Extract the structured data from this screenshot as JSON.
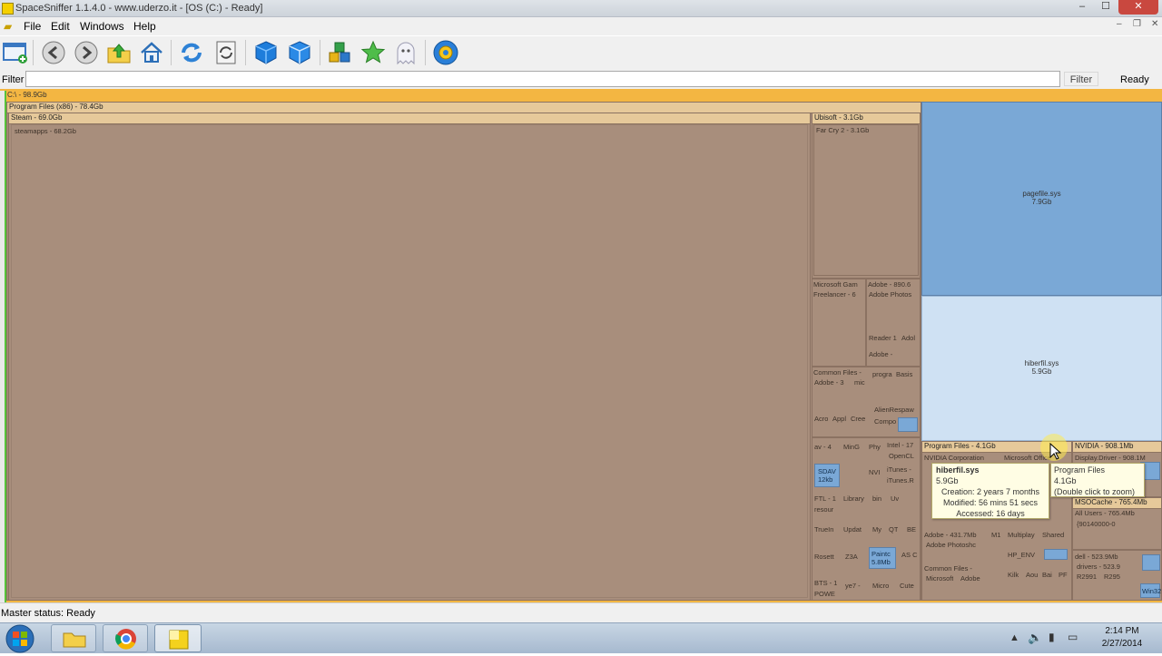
{
  "window": {
    "title": "SpaceSniffer 1.1.4.0 - www.uderzo.it - [OS (C:) - Ready]"
  },
  "menu": {
    "file": "File",
    "edit": "Edit",
    "windows": "Windows",
    "help": "Help"
  },
  "filter": {
    "label": "Filter",
    "value": "",
    "button": "Filter",
    "state": "Ready"
  },
  "treemap": {
    "root": "C:\\ - 98.9Gb",
    "program_files_x86": "Program Files (x86) - 78.4Gb",
    "steam": "Steam - 69.0Gb",
    "steamapps": "steamapps - 68.2Gb",
    "ubisoft": "Ubisoft - 3.1Gb",
    "far_cry": "Far Cry 2 - 3.1Gb",
    "microsoft_games": "Microsoft Gam",
    "freelancer": "Freelancer - 6",
    "adobe": "Adobe - 890.6",
    "adobe_photoshop": "Adobe Photos",
    "reader": "Reader 1",
    "adobe_small": "Adol",
    "adobe_dash": "Adobe -",
    "common_files": "Common Files -",
    "adobe_3": "Adobe - 3",
    "mic": "mic",
    "progra": "progra",
    "basis": "Basis",
    "alienrespawn": "AlienRespaw",
    "compo": "Compo",
    "acro": "Acro",
    "appl": "Appl",
    "cree": "Cree",
    "av": "av - 4",
    "ming": "MinG",
    "phy": "Phy",
    "intel": "Intel - 17",
    "opencl": "OpenCL",
    "sdav": "SDAV",
    "sdav_size": "12kb",
    "nvi": "NVI",
    "itunes": "iTunes -",
    "itunes2": "iTunes.R",
    "ftl": "FTL - 1",
    "resour": "resour",
    "library": "Library",
    "bin": "bin",
    "uv": "Uv",
    "truein": "TrueIn",
    "updat": "Updat",
    "my": "My",
    "qt": "QT",
    "be": "BE",
    "rosett": "Rosett",
    "z3a": "Z3A",
    "paintc": "Paintc",
    "paintc_size": "5.8Mb",
    "asc": "AS C",
    "bts": "BTS - 1",
    "powe": "POWE",
    "ye7": "ye7 -",
    "micro": "Micro",
    "cute": "Cute",
    "pagefile": "pagefile.sys",
    "pagefile_size": "7.9Gb",
    "hiberfil": "hiberfil.sys",
    "hiberfil_size": "5.9Gb",
    "program_files": "Program Files - 4.1Gb",
    "nvidia_corp": "NVIDIA Corporation",
    "microsoft_office": "Microsoft Office",
    "nvidia": "NVIDIA - 908.1Mb",
    "display_driver": "Display.Driver - 908.1M",
    "msocache": "MSOCache - 765.4Mb",
    "all_users": "All Users - 765.4Mb",
    "guid": "{90140000-0",
    "adobe_431": "Adobe - 431.7Mb",
    "adobe_photoshop2": "Adobe Photoshc",
    "m1": "M1",
    "multiplay": "Multiplay",
    "shared": "Shared",
    "hp_env": "HP_ENV",
    "common_files2": "Common Files -",
    "microsoft": "Microsoft",
    "adobe2": "Adobe",
    "kilk": "Kilk",
    "aou": "Aou",
    "bai": "Bai",
    "pf": "PF",
    "dell": "dell - 523.9Mb",
    "drivers": "drivers - 523.9",
    "r2991": "R2991",
    "r295": "R295",
    "win32": "Win32"
  },
  "tooltip": {
    "name": "hiberfil.sys",
    "size": "5.9Gb",
    "creation": "Creation: 2 years 7 months",
    "modified": "Modified: 56 mins 51 secs",
    "accessed": "Accessed: 16 days"
  },
  "tooltip2": {
    "name": "Program Files",
    "size": "4.1Gb",
    "hint": "(Double click to zoom)"
  },
  "status": {
    "text": "Master status: Ready"
  },
  "taskbar": {
    "time": "2:14 PM",
    "date": "2/27/2014"
  },
  "colors": {
    "folder": "#a88e7c",
    "header": "#e6c99a",
    "root": "#f3b642",
    "file_blue": "#7aa8d6",
    "file_light": "#cfe1f3"
  }
}
